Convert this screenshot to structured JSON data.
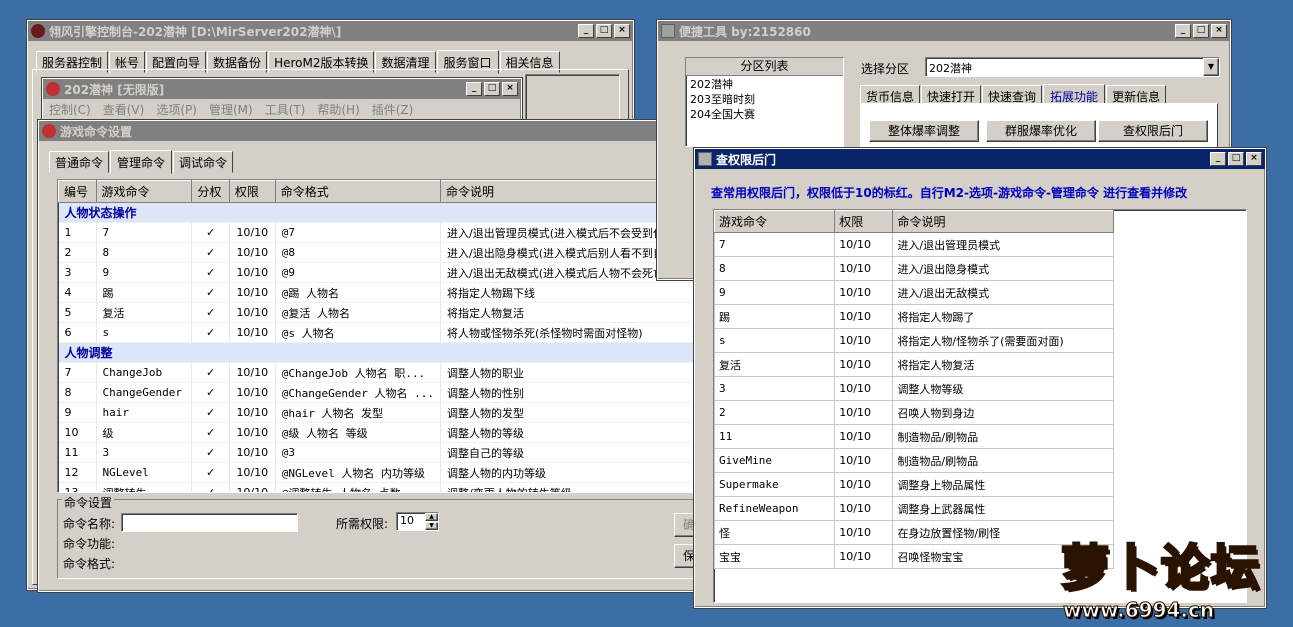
{
  "main_window": {
    "title": "翎风引擎控制台-202潜神 [D:\\MirServer202潜神\\]",
    "tabs": [
      "服务器控制",
      "帐号",
      "配置向导",
      "数据备份",
      "HeroM2版本转换",
      "数据清理",
      "服务窗口",
      "相关信息"
    ],
    "selected_tab": "服务窗口"
  },
  "m2_window": {
    "title": "202潜神 [无限版]",
    "menu": [
      "控制(C)",
      "查看(V)",
      "选项(P)",
      "管理(M)",
      "工具(T)",
      "帮助(H)",
      "插件(Z)"
    ]
  },
  "cmd_window": {
    "title": "游戏命令设置",
    "tabs": [
      "普通命令",
      "管理命令",
      "调试命令"
    ],
    "selected_tab": "管理命令",
    "columns": [
      "编号",
      "游戏命令",
      "分权",
      "权限",
      "命令格式",
      "命令说明"
    ],
    "groups": [
      {
        "name": "人物状态操作",
        "rows": [
          [
            "1",
            "7",
            "✓",
            "10/10",
            "@7",
            "进入/退出管理员模式(进入模式后不会受到任何"
          ],
          [
            "2",
            "8",
            "✓",
            "10/10",
            "@8",
            "进入/退出隐身模式(进入模式后别人看不到自己"
          ],
          [
            "3",
            "9",
            "✓",
            "10/10",
            "@9",
            "进入/退出无敌模式(进入模式后人物不会死亡)"
          ],
          [
            "4",
            "踢",
            "✓",
            "10/10",
            "@踢 人物名",
            "将指定人物踢下线"
          ],
          [
            "5",
            "复活",
            "✓",
            "10/10",
            "@复活 人物名",
            "将指定人物复活"
          ],
          [
            "6",
            "s",
            "✓",
            "10/10",
            "@s 人物名",
            "将人物或怪物杀死(杀怪物时需面对怪物)"
          ]
        ]
      },
      {
        "name": "人物调整",
        "rows": [
          [
            "7",
            "ChangeJob",
            "✓",
            "10/10",
            "@ChangeJob 人物名 职...",
            "调整人物的职业"
          ],
          [
            "8",
            "ChangeGender",
            "✓",
            "10/10",
            "@ChangeGender 人物名 ...",
            "调整人物的性别"
          ],
          [
            "9",
            "hair",
            "✓",
            "10/10",
            "@hair 人物名 发型",
            "调整人物的发型"
          ],
          [
            "10",
            "级",
            "✓",
            "10/10",
            "@级 人物名 等级",
            "调整人物的等级"
          ],
          [
            "11",
            "3",
            "✓",
            "10/10",
            "@3",
            "调整自己的等级"
          ],
          [
            "12",
            "NGLevel",
            "✓",
            "10/10",
            "@NGLevel 人物名 内功等级",
            "调整人物的内功等级"
          ],
          [
            "13",
            "调整转生",
            "✓",
            "10/10",
            "@调整转生 人物名 点数",
            "调整/变更人物的转生等级"
          ]
        ]
      }
    ],
    "settings": {
      "legend": "命令设置",
      "name_label": "命令名称:",
      "name_value": "",
      "perm_label": "所需权限:",
      "perm_value": "10",
      "func_label": "命令功能:",
      "format_label": "命令格式:",
      "btn1": "确",
      "btn2": "保"
    }
  },
  "tools_window": {
    "title": "便捷工具  by:2152860",
    "list_header": "分区列表",
    "list_items": [
      "202潜神",
      "203至暗时刻",
      "204全国大赛"
    ],
    "select_label": "选择分区",
    "select_value": "202潜神",
    "tabs": [
      "货币信息",
      "快速打开",
      "快速查询",
      "拓展功能",
      "更新信息"
    ],
    "selected_tab": "拓展功能",
    "buttons": [
      "整体爆率调整",
      "群服爆率优化",
      "查权限后门"
    ]
  },
  "perm_window": {
    "title": "查权限后门",
    "notice": "查常用权限后门，权限低于10的标红。自行M2-选项-游戏命令-管理命令 进行查看并修改",
    "columns": [
      "游戏命令",
      "权限",
      "命令说明"
    ],
    "rows": [
      [
        "7",
        "10/10",
        "进入/退出管理员模式"
      ],
      [
        "8",
        "10/10",
        "进入/退出隐身模式"
      ],
      [
        "9",
        "10/10",
        "进入/退出无敌模式"
      ],
      [
        "踢",
        "10/10",
        "将指定人物踢了"
      ],
      [
        "s",
        "10/10",
        "将指定人物/怪物杀了(需要面对面)"
      ],
      [
        "复活",
        "10/10",
        "将指定人物复活"
      ],
      [
        "3",
        "10/10",
        "调整人物等级"
      ],
      [
        "2",
        "10/10",
        "召唤人物到身边"
      ],
      [
        "11",
        "10/10",
        "制造物品/刷物品"
      ],
      [
        "GiveMine",
        "10/10",
        "制造物品/刷物品"
      ],
      [
        "Supermake",
        "10/10",
        "调整身上物品属性"
      ],
      [
        "RefineWeapon",
        "10/10",
        "调整身上武器属性"
      ],
      [
        "怪",
        "10/10",
        "在身边放置怪物/刷怪"
      ],
      [
        "宝宝",
        "10/10",
        "召唤怪物宝宝"
      ]
    ]
  },
  "watermark": {
    "text": "萝卜论坛",
    "url": "www.6994.cn"
  },
  "colors": {
    "desktop": "#3a6ea5",
    "active_title": "#0a246a",
    "notice_text": "#0000c0",
    "group_bg": "#dce6f6"
  }
}
